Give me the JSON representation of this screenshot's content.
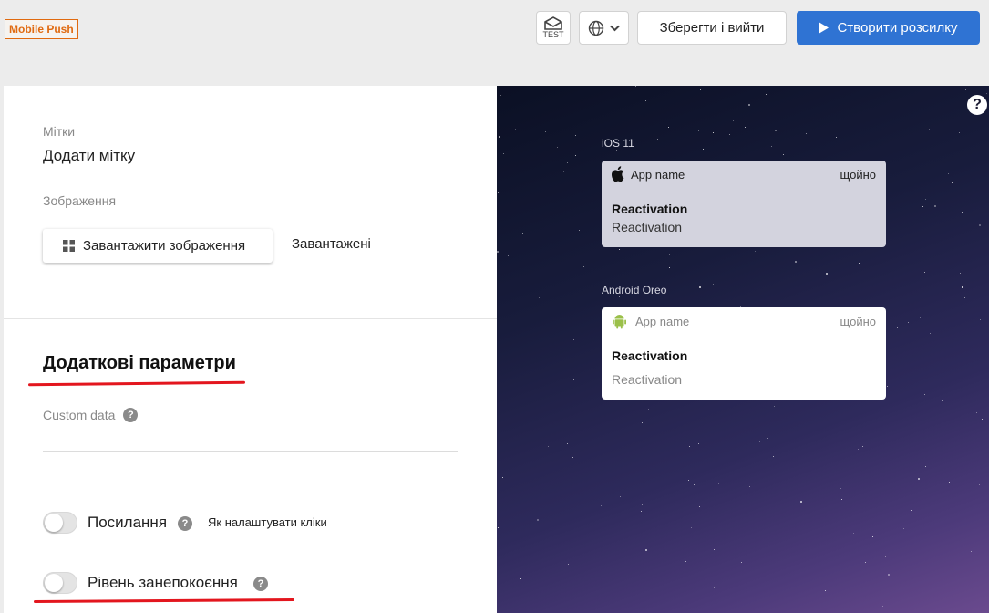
{
  "header": {
    "badge": "Mobile Push",
    "test_label": "TEST",
    "save_label": "Зберегти і вийти",
    "create_label": "Створити розсилку"
  },
  "colors": {
    "accent": "#2f73d3",
    "badge": "#e06a10",
    "annotation": "#e3161e"
  },
  "form": {
    "tags_label": "Мітки",
    "tags_value": "Додати мітку",
    "image_label": "Зображення",
    "upload_button": "Завантажити зображення",
    "uploaded_link": "Завантажені",
    "section_title": "Додаткові параметри",
    "custom_data_label": "Custom data",
    "link_toggle_label": "Посилання",
    "link_toggle_on": false,
    "clicks_help": "Як налаштувати кліки",
    "urgency_toggle_label": "Рівень занепокоєння",
    "urgency_toggle_on": false
  },
  "preview": {
    "ios": {
      "os_label": "iOS 11",
      "app_name": "App name",
      "time": "щойно",
      "title": "Reactivation",
      "body": "Reactivation"
    },
    "android": {
      "os_label": "Android Oreo",
      "app_name": "App name",
      "time": "щойно",
      "title": "Reactivation",
      "body": "Reactivation"
    }
  }
}
